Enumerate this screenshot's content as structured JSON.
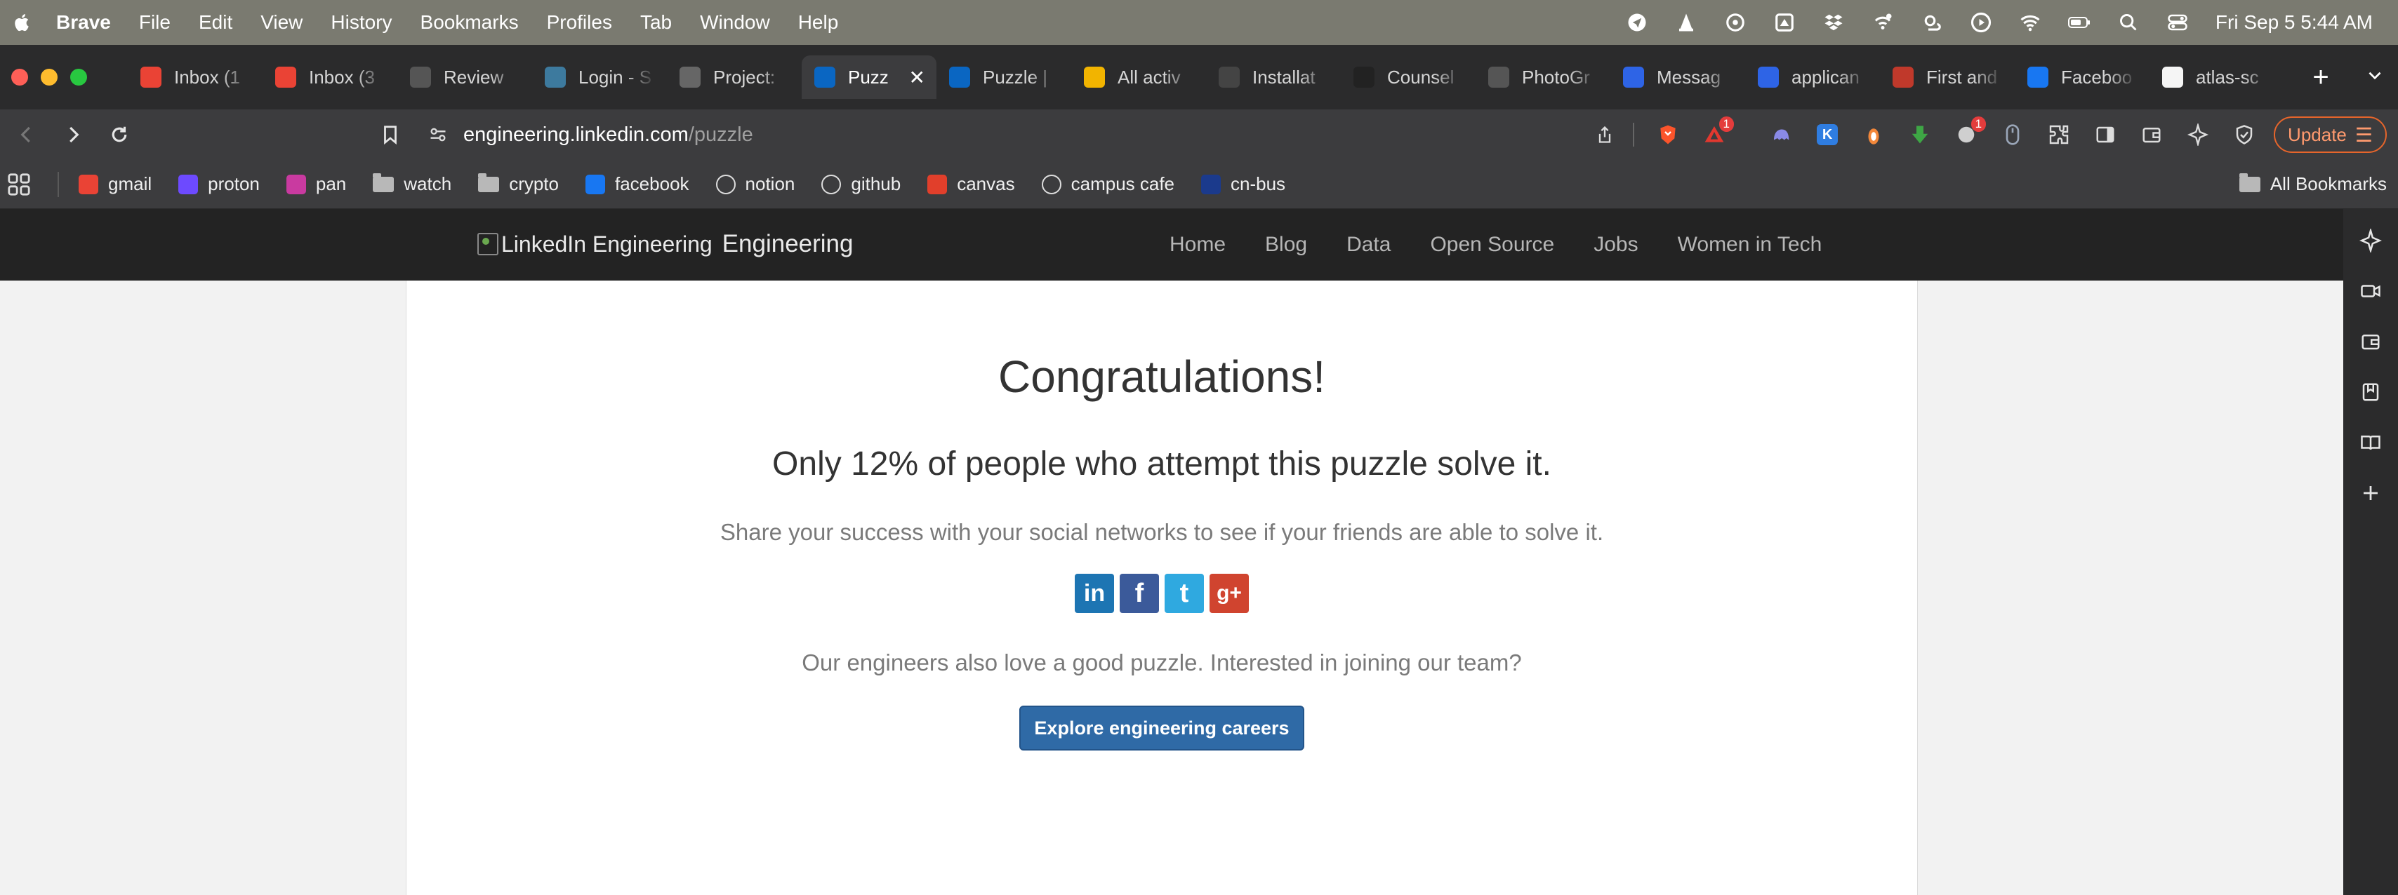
{
  "menubar": {
    "app_name": "Brave",
    "items": [
      "File",
      "Edit",
      "View",
      "History",
      "Bookmarks",
      "Profiles",
      "Tab",
      "Window",
      "Help"
    ],
    "clock": "Fri Sep 5  5:44 AM"
  },
  "tabs": [
    {
      "label": "Inbox (1",
      "icon": "gmail-icon",
      "color": "#ea4335"
    },
    {
      "label": "Inbox (3",
      "icon": "gmail-icon",
      "color": "#ea4335"
    },
    {
      "label": "Review",
      "icon": "review-icon",
      "color": "#555555"
    },
    {
      "label": "Login - S",
      "icon": "login-icon",
      "color": "#3d7a9e"
    },
    {
      "label": "Project:",
      "icon": "globe-icon",
      "color": "#666666"
    },
    {
      "label": "Puzz",
      "icon": "linkedin-icon",
      "color": "#0a66c2",
      "active": true
    },
    {
      "label": "Puzzle |",
      "icon": "linkedin-icon",
      "color": "#0a66c2"
    },
    {
      "label": "All activ",
      "icon": "activity-icon",
      "color": "#f2b400"
    },
    {
      "label": "Installat",
      "icon": "install-icon",
      "color": "#444444"
    },
    {
      "label": "Counsel",
      "icon": "counsel-icon",
      "color": "#222222"
    },
    {
      "label": "PhotoGr",
      "icon": "photo-icon",
      "color": "#555555"
    },
    {
      "label": "Messag",
      "icon": "message-icon",
      "color": "#2e64e6"
    },
    {
      "label": "applican",
      "icon": "applicant-icon",
      "color": "#2e64e6"
    },
    {
      "label": "First and",
      "icon": "flag-icon",
      "color": "#c0392b"
    },
    {
      "label": "Faceboo",
      "icon": "facebook-icon",
      "color": "#1877f2"
    },
    {
      "label": "atlas-sc",
      "icon": "github-icon",
      "color": "#f5f5f5"
    }
  ],
  "address": {
    "host": "engineering.linkedin.com",
    "path": "/puzzle"
  },
  "toolbar": {
    "brave_badge": "1",
    "ext_badge": "1",
    "update_label": "Update"
  },
  "bookmarks": [
    {
      "label": "gmail",
      "icon": "gmail-icon"
    },
    {
      "label": "proton",
      "icon": "proton-icon"
    },
    {
      "label": "pan",
      "icon": "pan-icon"
    },
    {
      "label": "watch",
      "icon": "folder-icon"
    },
    {
      "label": "crypto",
      "icon": "folder-icon"
    },
    {
      "label": "facebook",
      "icon": "facebook-icon"
    },
    {
      "label": "notion",
      "icon": "notion-icon"
    },
    {
      "label": "github",
      "icon": "github-icon"
    },
    {
      "label": "canvas",
      "icon": "canvas-icon"
    },
    {
      "label": "campus cafe",
      "icon": "campus-cafe-icon"
    },
    {
      "label": "cn-bus",
      "icon": "bus-icon"
    }
  ],
  "all_bookmarks_label": "All Bookmarks",
  "site": {
    "logo_alt": "LinkedIn Engineering",
    "brand": "Engineering",
    "nav": [
      "Home",
      "Blog",
      "Data",
      "Open Source",
      "Jobs",
      "Women in Tech"
    ]
  },
  "content": {
    "heading": "Congratulations!",
    "stat": "Only 12% of people who attempt this puzzle solve it.",
    "share_text": "Share your success with your social networks to see if your friends are able to solve it.",
    "joining_text": "Our engineers also love a good puzzle. Interested in joining our team?",
    "careers_button": "Explore engineering careers",
    "social": [
      {
        "name": "linkedin-share-icon",
        "glyph": "in",
        "color": "#1d75b3"
      },
      {
        "name": "facebook-share-icon",
        "glyph": "f",
        "color": "#3b5a9a"
      },
      {
        "name": "twitter-share-icon",
        "glyph": "t",
        "color": "#2fa9e0"
      },
      {
        "name": "googleplus-share-icon",
        "glyph": "g+",
        "color": "#d0442f"
      }
    ]
  }
}
